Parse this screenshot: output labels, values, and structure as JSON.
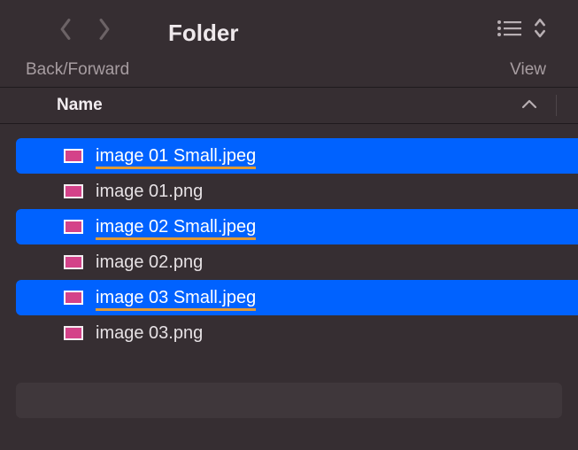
{
  "toolbar": {
    "title": "Folder",
    "nav_label": "Back/Forward",
    "view_label": "View"
  },
  "columns": {
    "name": "Name"
  },
  "files": [
    {
      "label": "image 01 Small.jpeg",
      "selected": true,
      "underline": true
    },
    {
      "label": "image 01.png",
      "selected": false,
      "underline": false
    },
    {
      "label": "image 02 Small.jpeg",
      "selected": true,
      "underline": true
    },
    {
      "label": "image 02.png",
      "selected": false,
      "underline": false
    },
    {
      "label": "image 03 Small.jpeg",
      "selected": true,
      "underline": true
    },
    {
      "label": "image 03.png",
      "selected": false,
      "underline": false
    }
  ]
}
